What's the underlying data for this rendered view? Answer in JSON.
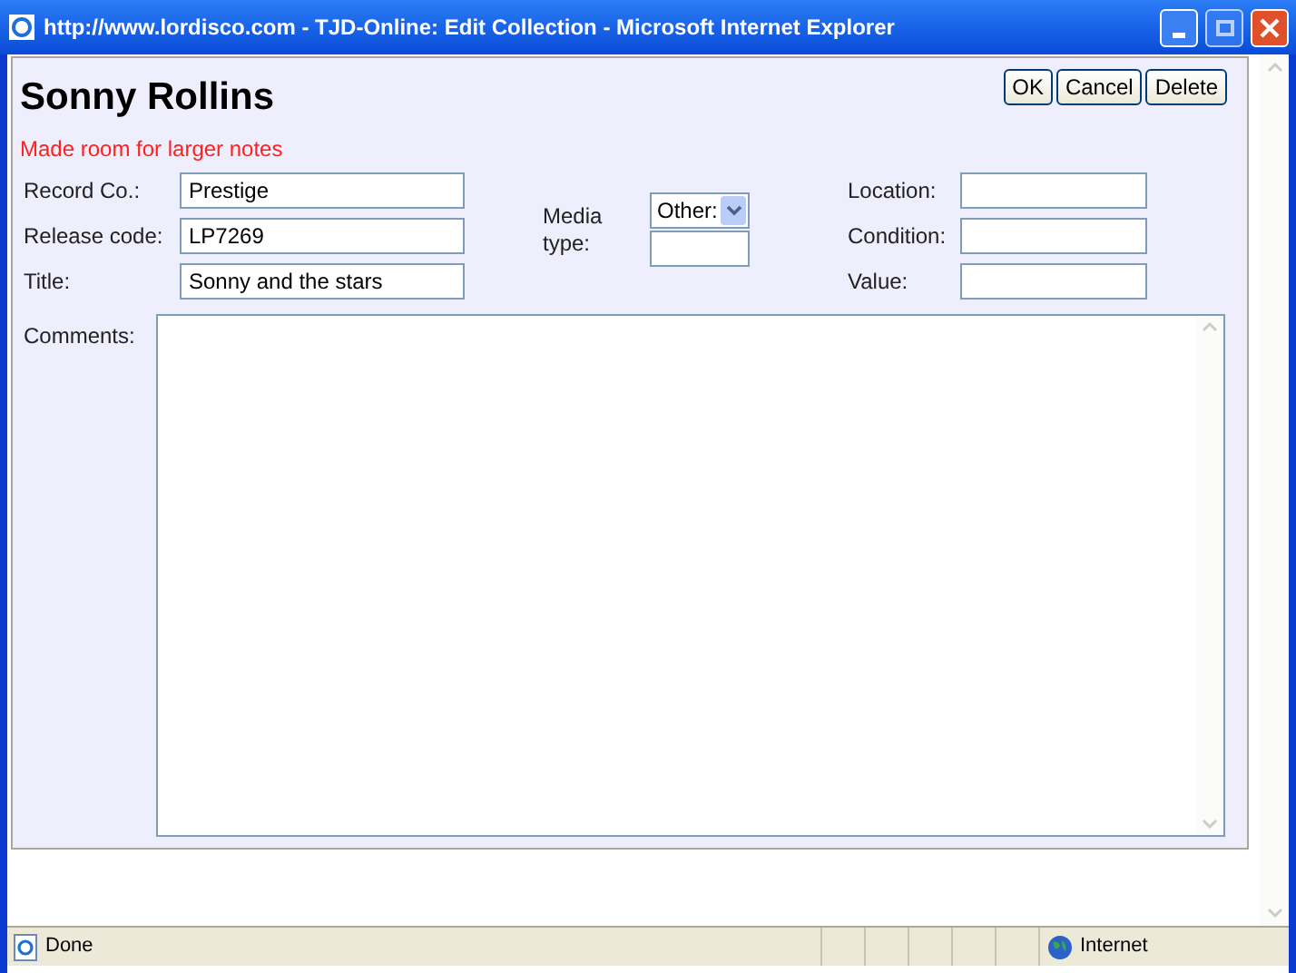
{
  "window": {
    "title": "http://www.lordisco.com - TJD-Online: Edit Collection - Microsoft Internet Explorer"
  },
  "heading": "Sonny Rollins",
  "notice": "Made room for larger notes",
  "buttons": [
    "OK",
    "Cancel",
    "Delete"
  ],
  "left_fields": [
    {
      "label": "Record Co.:",
      "value": "Prestige"
    },
    {
      "label": "Release code:",
      "value": "LP7269"
    },
    {
      "label": "Title:",
      "value": "Sonny and the stars"
    }
  ],
  "media": {
    "label": "Media type:",
    "select": "Other:"
  },
  "right_fields": [
    {
      "label": "Location:"
    },
    {
      "label": "Condition:"
    },
    {
      "label": "Value:"
    }
  ],
  "comments": {
    "label": "Comments:"
  },
  "status_bar": {
    "text": "Done",
    "zone": "Internet"
  }
}
